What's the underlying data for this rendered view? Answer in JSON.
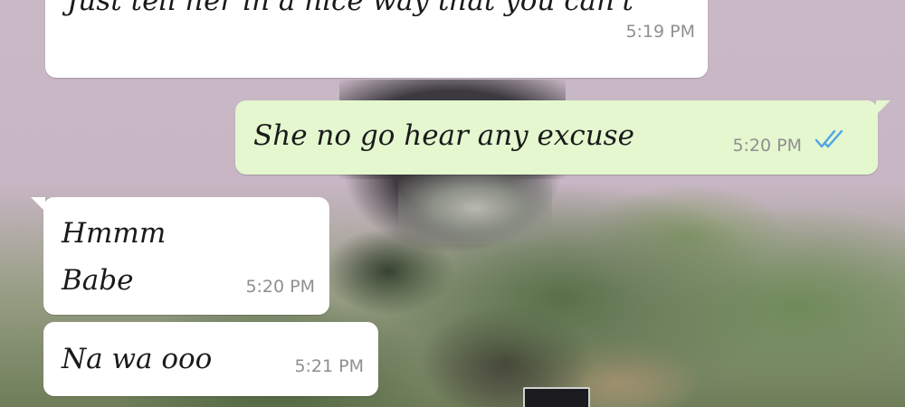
{
  "chat": {
    "messages": [
      {
        "direction": "incoming",
        "text": "Just tell her in a nice way that you can't",
        "time": "5:19 PM"
      },
      {
        "direction": "outgoing",
        "text": "She no go hear any excuse",
        "time": "5:20 PM",
        "status": "read",
        "status_icon": "double-check-icon",
        "status_color": "#4fa3e6"
      },
      {
        "direction": "incoming",
        "text_lines": [
          "Hmmm",
          "Babe"
        ],
        "time": "5:20 PM"
      },
      {
        "direction": "incoming",
        "text": "Na wa ooo",
        "time": "5:21 PM"
      }
    ]
  },
  "colors": {
    "incoming_bubble": "#ffffff",
    "outgoing_bubble": "#e4f7cf",
    "timestamp": "#8f8f8f",
    "read_ticks": "#4fa3e6"
  }
}
